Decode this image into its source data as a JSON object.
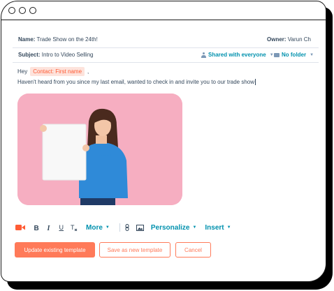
{
  "email": {
    "name_label": "Name:",
    "name_value": "Trade Show on the 24th!",
    "owner_label": "Owner:",
    "owner_value": "Varun Ch",
    "subject_label": "Subject:",
    "subject_value": "Intro to Video Selling",
    "shared": "Shared with everyone",
    "folder": "No folder"
  },
  "body": {
    "greeting": "Hey",
    "token": "Contact: First name",
    "after_token": ",",
    "line2": "Haven't heard from you since my last email, wanted to check in and invite you to our trade show"
  },
  "toolbar": {
    "more": "More",
    "personalize": "Personalize",
    "insert": "Insert"
  },
  "buttons": {
    "update": "Update existing template",
    "save_new": "Save as new template",
    "cancel": "Cancel"
  },
  "colors": {
    "accent": "#ff7a59",
    "link": "#0091ae",
    "text": "#33475b",
    "token_bg": "#fde3dc",
    "photo_bg": "#f6aec1"
  },
  "icons": [
    "video-icon",
    "bold-icon",
    "italic-icon",
    "underline-icon",
    "clear-format-icon",
    "link-icon",
    "image-icon"
  ]
}
